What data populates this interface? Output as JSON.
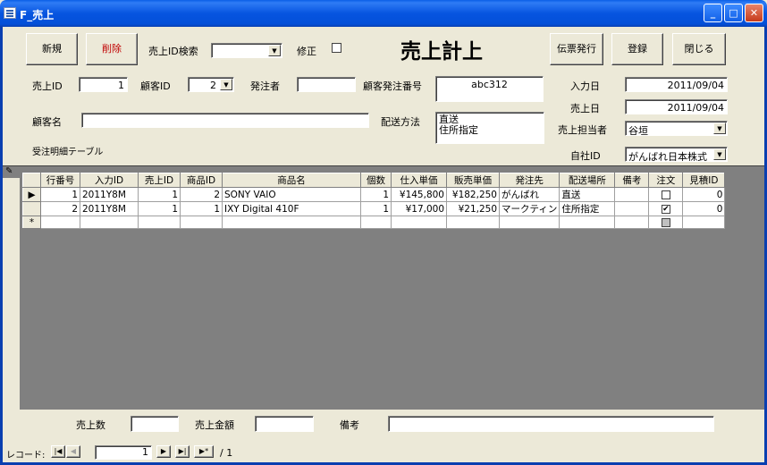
{
  "window": {
    "title": "F_売上",
    "min": "_",
    "max": "□",
    "close": "✕"
  },
  "toolbar": {
    "new_label": "新規",
    "delete_label": "削除",
    "search_label": "売上ID検索",
    "search_value": "",
    "edit_label": "修正",
    "heading": "売上計上",
    "slip_label": "伝票発行",
    "register_label": "登録",
    "close_label": "閉じる"
  },
  "fields": {
    "sales_id_label": "売上ID",
    "sales_id_value": "1",
    "customer_id_label": "顧客ID",
    "customer_id_value": "2",
    "orderer_label": "発注者",
    "orderer_value": "",
    "customer_order_no_label": "顧客発注番号",
    "customer_order_no_value": "abc312",
    "input_date_label": "入力日",
    "input_date_value": "2011/09/04",
    "sales_date_label": "売上日",
    "sales_date_value": "2011/09/04",
    "customer_name_label": "顧客名",
    "customer_name_value": "",
    "delivery_method_label": "配送方法",
    "delivery_method_value_1": "直送",
    "delivery_method_value_2": "住所指定",
    "sales_rep_label": "売上担当者",
    "sales_rep_value": "谷垣",
    "company_id_label": "自社ID",
    "company_id_value": "がんばれ日本株式",
    "subform_label": "受注明細テーブル"
  },
  "grid": {
    "columns": [
      "行番号",
      "入力ID",
      "売上ID",
      "商品ID",
      "商品名",
      "個数",
      "仕入単価",
      "販売単価",
      "発注先",
      "配送場所",
      "備考",
      "注文",
      "見積ID"
    ],
    "rows": [
      {
        "selector": "▶",
        "cells": [
          "1",
          "2011Y8M",
          "1",
          "2",
          "SONY  VAIO",
          "1",
          "¥145,800",
          "¥182,250",
          "がんばれ",
          "直送",
          "",
          "",
          "0"
        ],
        "order": ""
      },
      {
        "selector": "",
        "cells": [
          "2",
          "2011Y8M",
          "1",
          "1",
          "IXY Digital 410F",
          "1",
          "¥17,000",
          "¥21,250",
          "マークティン",
          "住所指定",
          "",
          "",
          "0"
        ],
        "order": "✔"
      }
    ],
    "new_row_selector": "*",
    "pencil": "✎"
  },
  "footer": {
    "sales_count_label": "売上数",
    "sales_count_value": "",
    "sales_amount_label": "売上金額",
    "sales_amount_value": "",
    "remarks_label": "備考",
    "remarks_value": ""
  },
  "navigation": {
    "record_label": "レコード:",
    "first": "|◀",
    "prev": "◀",
    "current": "1",
    "next": "▶",
    "last": "▶|",
    "new": "▶*",
    "total": "/ 1"
  }
}
